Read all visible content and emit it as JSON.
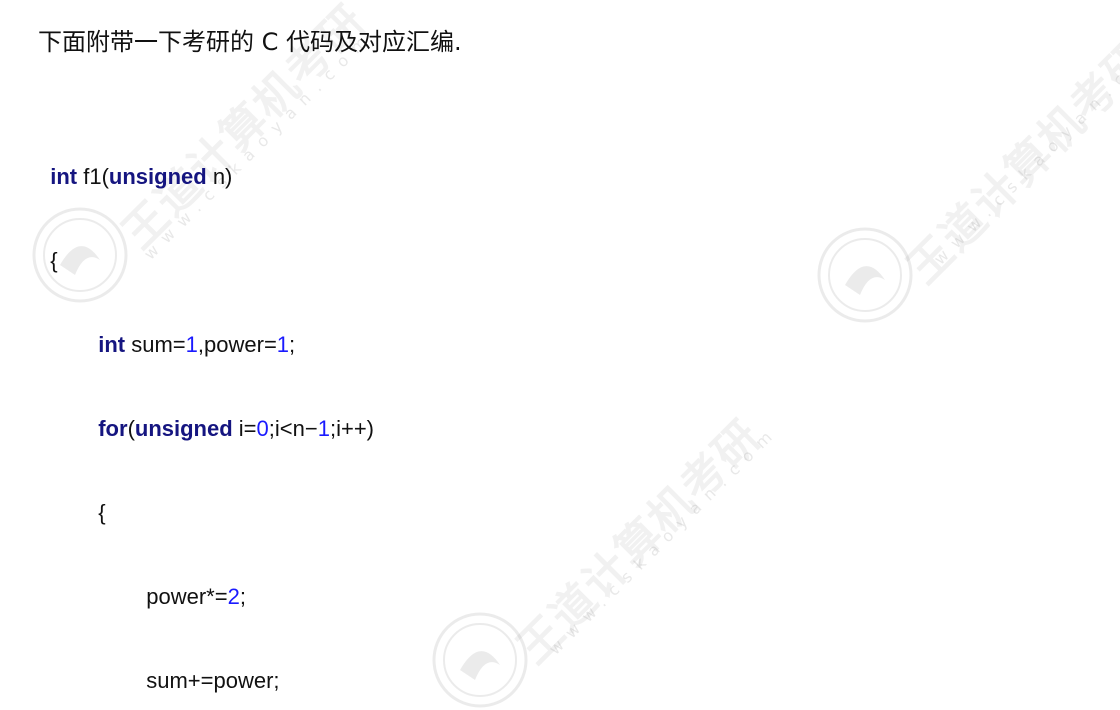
{
  "intro_text": "下面附带一下考研的 C 代码及对应汇编.",
  "code": {
    "l1": {
      "kw1": "int",
      "name": " f1(",
      "kw2": "unsigned",
      "rest": " n)"
    },
    "l2": "{",
    "l3": {
      "kw": "int",
      "a": " sum=",
      "n1": "1",
      "b": ",power=",
      "n2": "1",
      "c": ";"
    },
    "l4": {
      "kw1": "for",
      "a": "(",
      "kw2": "unsigned",
      "b": " i=",
      "n1": "0",
      "c": ";i<n−",
      "n2": "1",
      "d": ";i++)"
    },
    "l5": "{",
    "l6": {
      "a": "power*=",
      "n": "2",
      "b": ";"
    },
    "l7": "sum+=power;"
  },
  "watermark": {
    "brand": "王道计算机考研",
    "url": "www.cskaoyan.com"
  }
}
